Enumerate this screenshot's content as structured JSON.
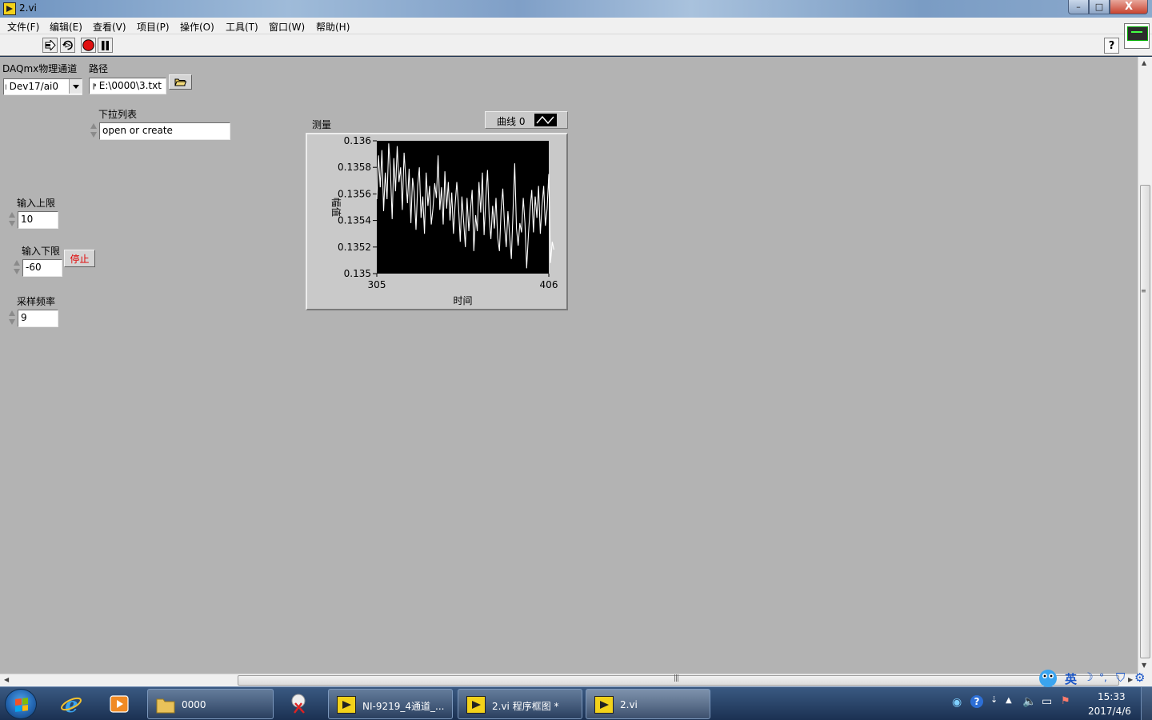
{
  "window": {
    "title": "2.vi",
    "min_symbol": "–",
    "max_symbol": "□",
    "close_symbol": "X"
  },
  "menu": [
    "文件(F)",
    "编辑(E)",
    "查看(V)",
    "项目(P)",
    "操作(O)",
    "工具(T)",
    "窗口(W)",
    "帮助(H)"
  ],
  "toolbar": {
    "help_label": "?"
  },
  "panel": {
    "daqmx_label": "DAQmx物理通道",
    "daqmx_value": "Dev17/ai0",
    "daqmx_prefix": "I",
    "path_label": "路径",
    "path_value": "E:\\0000\\3.txt",
    "dropdown_label": "下拉列表",
    "dropdown_value": "open or create",
    "upper_label": "输入上限",
    "upper_value": "10",
    "stop_label": "停止",
    "lower_label": "输入下限",
    "lower_value": "-60",
    "rate_label": "采样频率",
    "rate_value": "9"
  },
  "graph": {
    "title": "测量",
    "legend_label": "曲线 0",
    "plot_bg": "#000000",
    "trace_color": "#ffffff",
    "chart_data": {
      "type": "line",
      "title": "测量",
      "xlabel": "时间",
      "ylabel": "幅值",
      "xlim": [
        305,
        406
      ],
      "ylim": [
        0.135,
        0.136
      ],
      "x_ticks": [
        "305",
        "406"
      ],
      "y_ticks": [
        "0.136",
        "0.1358",
        "0.1356",
        "0.1354",
        "0.1352",
        "0.135"
      ],
      "series": [
        {
          "name": "曲线 0",
          "x_start": 305,
          "x_step": 1,
          "values": [
            0.13556,
            0.13589,
            0.13565,
            0.13593,
            0.13547,
            0.13576,
            0.13556,
            0.13598,
            0.13578,
            0.13541,
            0.13587,
            0.13562,
            0.13596,
            0.13569,
            0.1358,
            0.13548,
            0.13591,
            0.13572,
            0.13553,
            0.13579,
            0.13538,
            0.13572,
            0.13561,
            0.13533,
            0.13566,
            0.1358,
            0.13542,
            0.13558,
            0.1353,
            0.13576,
            0.13551,
            0.13566,
            0.13537,
            0.13549,
            0.13568,
            0.13557,
            0.13589,
            0.13548,
            0.13565,
            0.13537,
            0.13577,
            0.13549,
            0.13569,
            0.1354,
            0.13561,
            0.1353,
            0.13552,
            0.13569,
            0.1355,
            0.13524,
            0.13558,
            0.13539,
            0.1352,
            0.13557,
            0.13532,
            0.13548,
            0.13563,
            0.13517,
            0.13544,
            0.13532,
            0.13569,
            0.13546,
            0.13576,
            0.13529,
            0.13556,
            0.13578,
            0.13542,
            0.13526,
            0.13551,
            0.13534,
            0.13557,
            0.13527,
            0.13517,
            0.13548,
            0.13564,
            0.13536,
            0.1352,
            0.13547,
            0.13529,
            0.13511,
            0.13547,
            0.13583,
            0.13534,
            0.13521,
            0.13538,
            0.13531,
            0.13557,
            0.13538,
            0.13504,
            0.13529,
            0.13549,
            0.13563,
            0.13531,
            0.13558,
            0.13542,
            0.13566,
            0.1353,
            0.13551,
            0.13566,
            0.13536,
            0.13549,
            0.13575,
            0.13508,
            0.13524,
            0.13518
          ]
        }
      ]
    }
  },
  "taskbar": {
    "tasks": [
      "0000",
      "NI-9219_4通道_...",
      "2.vi 程序框图 *",
      "2.vi"
    ],
    "ime_label": "英",
    "time": "15:33",
    "date": "2017/4/6"
  }
}
